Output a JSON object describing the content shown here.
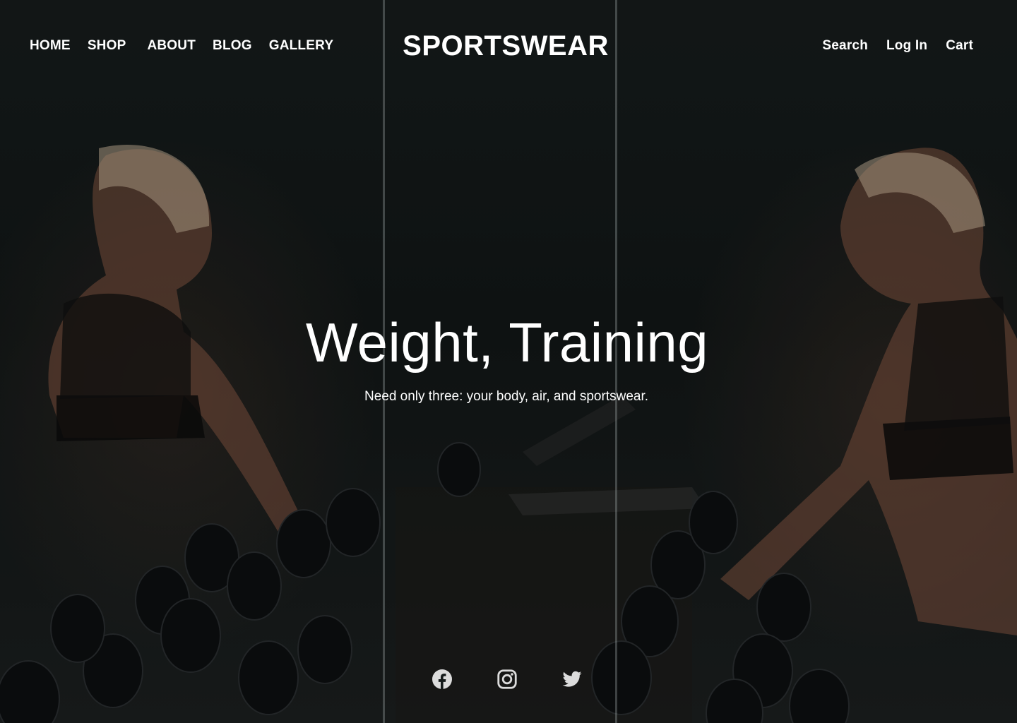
{
  "nav": {
    "left": [
      {
        "label": "HOME"
      },
      {
        "label": "SHOP"
      },
      {
        "label": "ABOUT"
      },
      {
        "label": "BLOG"
      },
      {
        "label": "GALLERY"
      }
    ],
    "brand": "SPORTSWEAR",
    "right": [
      {
        "label": "Search"
      },
      {
        "label": "Log In"
      },
      {
        "label": "Cart"
      }
    ]
  },
  "hero": {
    "headline": "Weight, Training",
    "subline": "Need only three: your body, air, and sportswear."
  },
  "social": [
    {
      "icon": "facebook-icon"
    },
    {
      "icon": "instagram-icon"
    },
    {
      "icon": "twitter-icon"
    }
  ],
  "colors": {
    "text": "#ffffff",
    "background": "#141a1a",
    "icon": "#dcdcdc"
  }
}
